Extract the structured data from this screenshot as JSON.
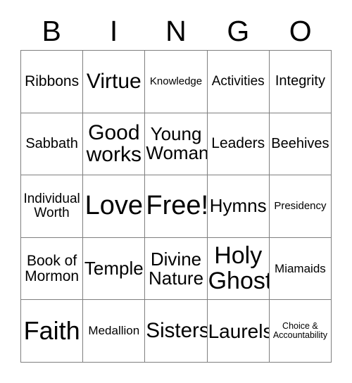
{
  "card": {
    "header_letters": [
      "B",
      "I",
      "N",
      "G",
      "O"
    ],
    "grid_size": "5x5",
    "border_color": "#7f7f7f",
    "text_color": "#000000",
    "background_color": "#ffffff",
    "rows": [
      [
        {
          "text": "Ribbons",
          "size_class": "fs-21"
        },
        {
          "text": "Virtue",
          "size_class": "fs-30"
        },
        {
          "text": "Knowledge",
          "size_class": "fs-15"
        },
        {
          "text": "Activities",
          "size_class": "fs-19"
        },
        {
          "text": "Integrity",
          "size_class": "fs-20"
        }
      ],
      [
        {
          "text": "Sabbath",
          "size_class": "fs-20"
        },
        {
          "text": "Good\nworks",
          "size_class": "fs-30"
        },
        {
          "text": "Young\nWoman",
          "size_class": "fs-26"
        },
        {
          "text": "Leaders",
          "size_class": "fs-21"
        },
        {
          "text": "Beehives",
          "size_class": "fs-20"
        }
      ],
      [
        {
          "text": "Individual\nWorth",
          "size_class": "fs-19"
        },
        {
          "text": "Love",
          "size_class": "fs-38"
        },
        {
          "text": "Free!",
          "size_class": "fs-38"
        },
        {
          "text": "Hymns",
          "size_class": "fs-26"
        },
        {
          "text": "Presidency",
          "size_class": "fs-15"
        }
      ],
      [
        {
          "text": "Book of\nMormon",
          "size_class": "fs-21"
        },
        {
          "text": "Temple",
          "size_class": "fs-26"
        },
        {
          "text": "Divine\nNature",
          "size_class": "fs-26"
        },
        {
          "text": "Holy\nGhost",
          "size_class": "fs-34"
        },
        {
          "text": "Miamaids",
          "size_class": "fs-17"
        }
      ],
      [
        {
          "text": "Faith",
          "size_class": "fs-36"
        },
        {
          "text": "Medallion",
          "size_class": "fs-17"
        },
        {
          "text": "Sisters",
          "size_class": "fs-29"
        },
        {
          "text": "Laurels",
          "size_class": "fs-28"
        },
        {
          "text": "Choice &\nAccountability",
          "size_class": "fs-12"
        }
      ]
    ]
  }
}
